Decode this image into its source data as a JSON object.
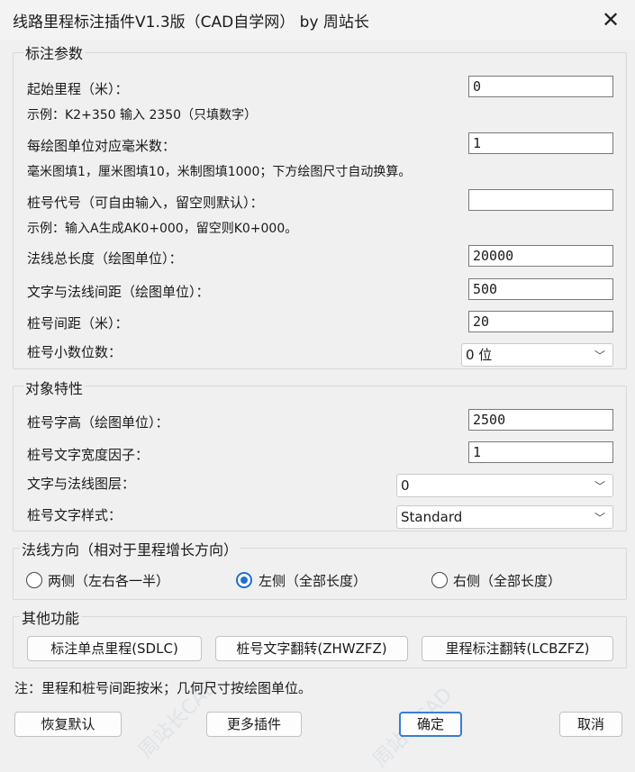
{
  "window": {
    "title": "线路里程标注插件V1.3版（CAD自学网） by 周站长",
    "close_glyph": "✕"
  },
  "params": {
    "legend": "标注参数",
    "start_label": "起始里程（米）：",
    "start_value": "0",
    "start_hint": "示例：K2+350 输入 2350（只填数字）",
    "mm_label": "每绘图单位对应毫米数：",
    "mm_value": "1",
    "mm_hint": "毫米图填1，厘米图填10，米制图填1000；下方绘图尺寸自动换算。",
    "prefix_label": "桩号代号（可自由输入，留空则默认）：",
    "prefix_value": "",
    "prefix_hint": "示例：输入A生成AK0+000，留空则K0+000。",
    "length_label": "法线总长度（绘图单位）：",
    "length_value": "20000",
    "gap_label": "文字与法线间距（绘图单位）：",
    "gap_value": "500",
    "interval_label": "桩号间距（米）：",
    "interval_value": "20",
    "decimals_label": "桩号小数位数：",
    "decimals_value": "0 位"
  },
  "object": {
    "legend": "对象特性",
    "height_label": "桩号字高（绘图单位）：",
    "height_value": "2500",
    "width_label": "桩号文字宽度因子：",
    "width_value": "1",
    "layer_label": "文字与法线图层：",
    "layer_value": "0",
    "style_label": "桩号文字样式：",
    "style_value": "Standard"
  },
  "direction": {
    "legend": "法线方向（相对于里程增长方向）",
    "options": [
      "两侧（左右各一半）",
      "左侧（全部长度）",
      "右侧（全部长度）"
    ],
    "selected": "左侧（全部长度）"
  },
  "other": {
    "legend": "其他功能",
    "buttons": [
      "标注单点里程(SDLC)",
      "桩号文字翻转(ZHWZFZ)",
      "里程标注翻转(LCBZFZ)"
    ]
  },
  "footer": {
    "note": "注：里程和桩号间距按米；几何尺寸按绘图单位。",
    "reset": "恢复默认",
    "more": "更多插件",
    "ok": "确定",
    "cancel": "取消"
  },
  "icons": {
    "chevron": "chevron-down-icon"
  },
  "colors": {
    "accent": "#1f6fd1",
    "background": "#f0f0f0"
  }
}
